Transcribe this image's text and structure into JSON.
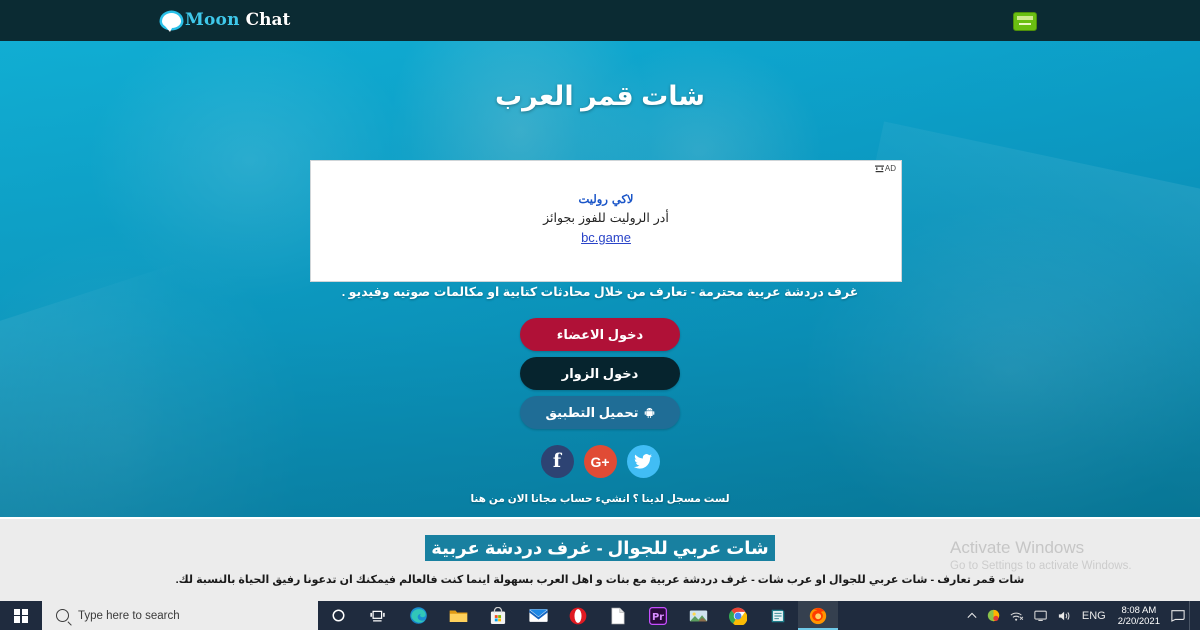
{
  "topnav": {
    "logo_moon": "Moon",
    "logo_chat": "Chat",
    "bubble_icon": "chat-bubble-icon",
    "badge_icon": "green-banner-icon",
    "bg_color": "#0b2b33"
  },
  "hero": {
    "page_title": "شات قمر العرب",
    "tagline": "غرف دردشة عربية محترمة - تعارف من خلال محادثات كتابية او مكالمات صوتيه وفيديو .",
    "signup_text": "لست مسجل لدينا ؟ انشيء حساب مجانا الان من هنا",
    "accent_color": "#0fa5ce"
  },
  "ad": {
    "label": "AD",
    "title": "لاكي روليت",
    "description": "أدر الروليت للفوز بجوائز",
    "link": "bc.game"
  },
  "buttons": [
    {
      "label": "دخول الاعضاء",
      "color": "#b01137",
      "name": "members-login-button",
      "icon": ""
    },
    {
      "label": "دخول الزوار",
      "color": "#06242e",
      "name": "guests-login-button",
      "icon": ""
    },
    {
      "label": "تحميل التطبيق",
      "color": "#1f6d96",
      "name": "download-app-button",
      "icon": "android-icon"
    }
  ],
  "social": [
    {
      "name": "facebook-icon",
      "label": "f",
      "color": "#2d4373"
    },
    {
      "name": "google-plus-icon",
      "label": "G+",
      "color": "#e04b35"
    },
    {
      "name": "twitter-icon",
      "label": "",
      "color": "#41bdf5"
    }
  ],
  "footer": {
    "heading": "شات عربي للجوال - غرف دردشة عربية",
    "heading_highlight_color": "#1880a0",
    "paragraph": "شات قمر تعارف - شات عربي للجوال او عرب شات - غرف دردشة عربية مع بنات و اهل العرب بسهولة اينما كنت فالعالم فيمكنك ان تدعونا رفيق الحياة بالنسبة لك."
  },
  "watermark": {
    "line1": "Activate Windows",
    "line2": "Go to Settings to activate Windows."
  },
  "taskbar": {
    "start_icon": "windows-start-icon",
    "search_placeholder": "Type here to search",
    "icons": [
      {
        "name": "cortana-icon"
      },
      {
        "name": "task-view-icon"
      },
      {
        "name": "microsoft-edge-icon"
      },
      {
        "name": "file-explorer-icon"
      },
      {
        "name": "microsoft-store-icon"
      },
      {
        "name": "mail-icon"
      },
      {
        "name": "opera-browser-icon"
      },
      {
        "name": "document-icon"
      },
      {
        "name": "premiere-pro-icon"
      },
      {
        "name": "photos-app-icon"
      },
      {
        "name": "google-chrome-icon"
      },
      {
        "name": "notes-app-icon"
      },
      {
        "name": "firefox-browser-icon"
      }
    ],
    "tray": {
      "chevron": "show-hidden-icons",
      "language": "ENG",
      "time": "8:08 AM",
      "date": "2/20/2021",
      "notification_icon": "action-center-icon"
    }
  }
}
